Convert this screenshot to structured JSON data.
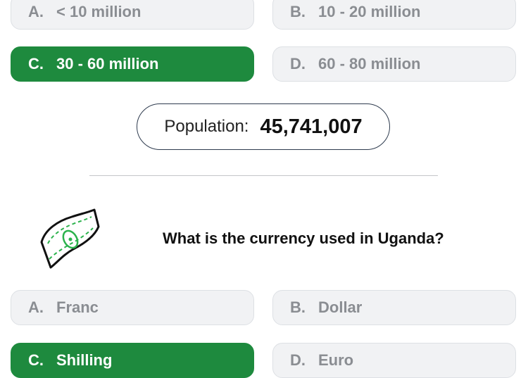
{
  "q1_options": [
    {
      "letter": "A.",
      "text": "< 10 million"
    },
    {
      "letter": "B.",
      "text": "10 - 20 million"
    },
    {
      "letter": "C.",
      "text": "30 - 60 million"
    },
    {
      "letter": "D.",
      "text": "60 - 80 million"
    }
  ],
  "population": {
    "label": "Population:",
    "value": "45,741,007"
  },
  "q2": {
    "icon": "money-bill-icon",
    "question": "What is the currency used in Uganda?",
    "options": [
      {
        "letter": "A.",
        "text": "Franc"
      },
      {
        "letter": "B.",
        "text": "Dollar"
      },
      {
        "letter": "C.",
        "text": "Shilling"
      },
      {
        "letter": "D.",
        "text": "Euro"
      }
    ]
  },
  "colors": {
    "correct": "#1e8a3e",
    "option_bg": "#f1f2f4",
    "option_text": "#8a8d92",
    "pill_border": "#2e3b4e"
  }
}
